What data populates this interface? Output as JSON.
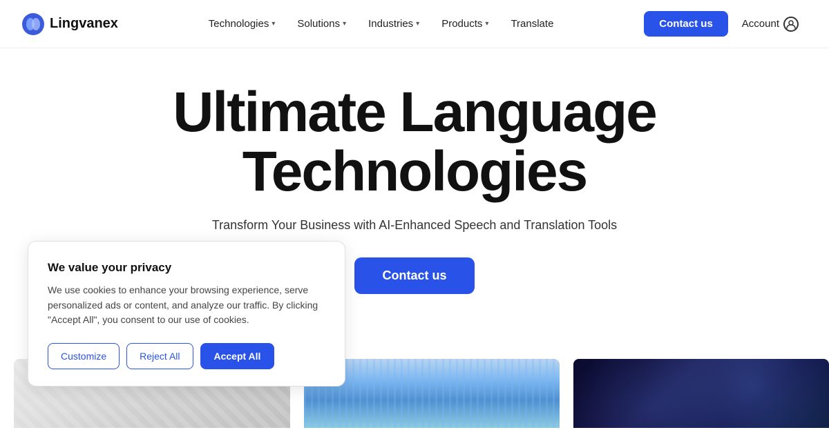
{
  "logo": {
    "text": "Lingvanex"
  },
  "nav": {
    "links": [
      {
        "label": "Technologies",
        "hasDropdown": true
      },
      {
        "label": "Solutions",
        "hasDropdown": true
      },
      {
        "label": "Industries",
        "hasDropdown": true
      },
      {
        "label": "Products",
        "hasDropdown": true
      },
      {
        "label": "Translate",
        "hasDropdown": false
      }
    ],
    "contact_button": "Contact us",
    "account_label": "Account"
  },
  "hero": {
    "title_line1": "Ultimate Language",
    "title_line2": "Technologies",
    "subtitle": "Transform Your Business with AI-Enhanced Speech and Translation Tools",
    "cta_label": "Contact us"
  },
  "cookie": {
    "title": "We value your privacy",
    "text": "We use cookies to enhance your browsing experience, serve personalized ads or content, and analyze our traffic. By clicking \"Accept All\", you consent to our use of cookies.",
    "customize_label": "Customize",
    "reject_label": "Reject All",
    "accept_label": "Accept All"
  }
}
